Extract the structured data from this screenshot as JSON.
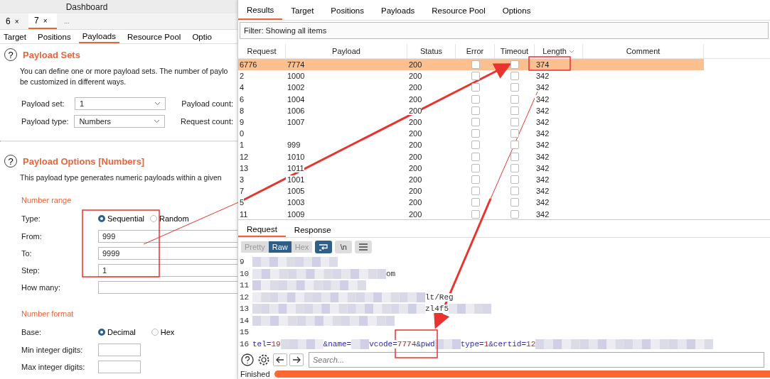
{
  "left_panel": {
    "title": "Dashboard",
    "tabs": [
      {
        "label": "6",
        "close": "×",
        "selected": false
      },
      {
        "label": "7",
        "close": "×",
        "selected": true
      }
    ],
    "more": "...",
    "subtabs": [
      {
        "label": "Target",
        "selected": false
      },
      {
        "label": "Positions",
        "selected": false
      },
      {
        "label": "Payloads",
        "selected": true
      },
      {
        "label": "Resource Pool",
        "selected": false
      },
      {
        "label": "Optio",
        "selected": false
      }
    ],
    "payload_sets": {
      "help": "?",
      "title": "Payload Sets",
      "description": [
        "You can define one or more payload sets. The number of paylo",
        "be customized in different ways."
      ],
      "fields": [
        {
          "label": "Payload set:",
          "value": "1",
          "side_label": "Payload count:"
        },
        {
          "label": "Payload type:",
          "value": "Numbers",
          "side_label": "Request count:"
        }
      ]
    },
    "payload_options": {
      "help": "?",
      "title": "Payload Options [Numbers]",
      "description": "This payload type generates numeric payloads within a given",
      "number_range": {
        "heading": "Number range",
        "type_label": "Type:",
        "radios": [
          {
            "label": "Sequential",
            "selected": true
          },
          {
            "label": "Random",
            "selected": false
          }
        ],
        "fields": [
          {
            "label": "From:",
            "value": "999"
          },
          {
            "label": "To:",
            "value": "9999"
          },
          {
            "label": "Step:",
            "value": "1"
          },
          {
            "label": "How many:"
          }
        ]
      },
      "number_format": {
        "heading": "Number format",
        "base_label": "Base:",
        "radios": [
          {
            "label": "Decimal",
            "selected": true
          },
          {
            "label": "Hex",
            "selected": false
          }
        ],
        "fields": [
          {
            "label": "Min integer digits:"
          },
          {
            "label": "Max integer digits:"
          }
        ]
      }
    }
  },
  "right_panel": {
    "tabs": [
      {
        "label": "Results",
        "selected": true
      },
      {
        "label": "Target",
        "selected": false
      },
      {
        "label": "Positions",
        "selected": false
      },
      {
        "label": "Payloads",
        "selected": false
      },
      {
        "label": "Resource Pool",
        "selected": false
      },
      {
        "label": "Options",
        "selected": false
      }
    ],
    "filter": "Filter: Showing all items",
    "table": {
      "columns": [
        {
          "label": "Request",
          "sorted": false
        },
        {
          "label": "Payload",
          "sorted": false
        },
        {
          "label": "Status",
          "sorted": false
        },
        {
          "label": "Error",
          "sorted": false
        },
        {
          "label": "Timeout",
          "sorted": false
        },
        {
          "label": "Length",
          "sorted": true
        },
        {
          "label": "Comment",
          "sorted": false
        }
      ],
      "rows": [
        {
          "request": "6776",
          "payload": "7774",
          "status": "200",
          "error": false,
          "timeout": false,
          "length": "374",
          "selected": true
        },
        {
          "request": "2",
          "payload": "1000",
          "status": "200",
          "error": false,
          "timeout": false,
          "length": "342",
          "selected": false
        },
        {
          "request": "4",
          "payload": "1002",
          "status": "200",
          "error": false,
          "timeout": false,
          "length": "342",
          "selected": false
        },
        {
          "request": "6",
          "payload": "1004",
          "status": "200",
          "error": false,
          "timeout": false,
          "length": "342",
          "selected": false
        },
        {
          "request": "8",
          "payload": "1006",
          "status": "200",
          "error": false,
          "timeout": false,
          "length": "342",
          "selected": false
        },
        {
          "request": "9",
          "payload": "1007",
          "status": "200",
          "error": false,
          "timeout": false,
          "length": "342",
          "selected": false
        },
        {
          "request": "0",
          "status": "200",
          "error": false,
          "timeout": false,
          "length": "342",
          "selected": false
        },
        {
          "request": "1",
          "payload": "999",
          "status": "200",
          "error": false,
          "timeout": false,
          "length": "342",
          "selected": false
        },
        {
          "request": "12",
          "payload": "1010",
          "status": "200",
          "error": false,
          "timeout": false,
          "length": "342",
          "selected": false
        },
        {
          "request": "13",
          "payload": "1011",
          "status": "200",
          "error": false,
          "timeout": false,
          "length": "342",
          "selected": false
        },
        {
          "request": "3",
          "payload": "1001",
          "status": "200",
          "error": false,
          "timeout": false,
          "length": "342",
          "selected": false
        },
        {
          "request": "7",
          "payload": "1005",
          "status": "200",
          "error": false,
          "timeout": false,
          "length": "342",
          "selected": false
        },
        {
          "request": "5",
          "payload": "1003",
          "status": "200",
          "error": false,
          "timeout": false,
          "length": "342",
          "selected": false
        },
        {
          "request": "11",
          "payload": "1009",
          "status": "200",
          "error": false,
          "timeout": false,
          "length": "342",
          "selected": false
        }
      ]
    },
    "editor": {
      "tabs": [
        {
          "label": "Request",
          "selected": true
        },
        {
          "label": "Response",
          "selected": false
        }
      ],
      "views": [
        {
          "label": "Pretty",
          "selected": false
        },
        {
          "label": "Raw",
          "selected": true
        },
        {
          "label": "Hex",
          "selected": false
        }
      ],
      "wrap_on": true,
      "newline": {
        "label": "\\n",
        "on": false
      },
      "lines": [
        {
          "number": "9",
          "segments": [
            {
              "kind": "redacted"
            }
          ]
        },
        {
          "number": "10",
          "segments": [
            {
              "kind": "redacted"
            },
            {
              "kind": "plain",
              "text": "om"
            }
          ]
        },
        {
          "number": "11",
          "segments": [
            {
              "kind": "redacted"
            }
          ]
        },
        {
          "number": "12",
          "segments": [
            {
              "kind": "redacted"
            },
            {
              "kind": "plain",
              "text": "lt/Reg"
            }
          ]
        },
        {
          "number": "13",
          "segments": [
            {
              "kind": "redacted"
            },
            {
              "kind": "plain",
              "text": "zl4f5"
            },
            {
              "kind": "redacted"
            }
          ]
        },
        {
          "number": "14",
          "segments": [
            {
              "kind": "redacted"
            }
          ]
        },
        {
          "number": "15"
        },
        {
          "number": "16",
          "segments": [
            {
              "kind": "key",
              "text": "tel="
            },
            {
              "kind": "value",
              "text": "19"
            },
            {
              "kind": "redacted"
            },
            {
              "kind": "key",
              "text": "&name="
            },
            {
              "kind": "redacted"
            },
            {
              "kind": "key",
              "text": "vcode="
            },
            {
              "kind": "value",
              "text": "7774"
            },
            {
              "kind": "key",
              "text": "&pwd"
            },
            {
              "kind": "redacted"
            },
            {
              "kind": "key",
              "text": "type="
            },
            {
              "kind": "value",
              "text": "1"
            },
            {
              "kind": "key",
              "text": "&certid="
            },
            {
              "kind": "value",
              "text": "12"
            },
            {
              "kind": "redacted"
            }
          ]
        }
      ],
      "search": {
        "placeholder": "Search..."
      }
    },
    "status": {
      "text": "Finished",
      "level": 1
    }
  }
}
